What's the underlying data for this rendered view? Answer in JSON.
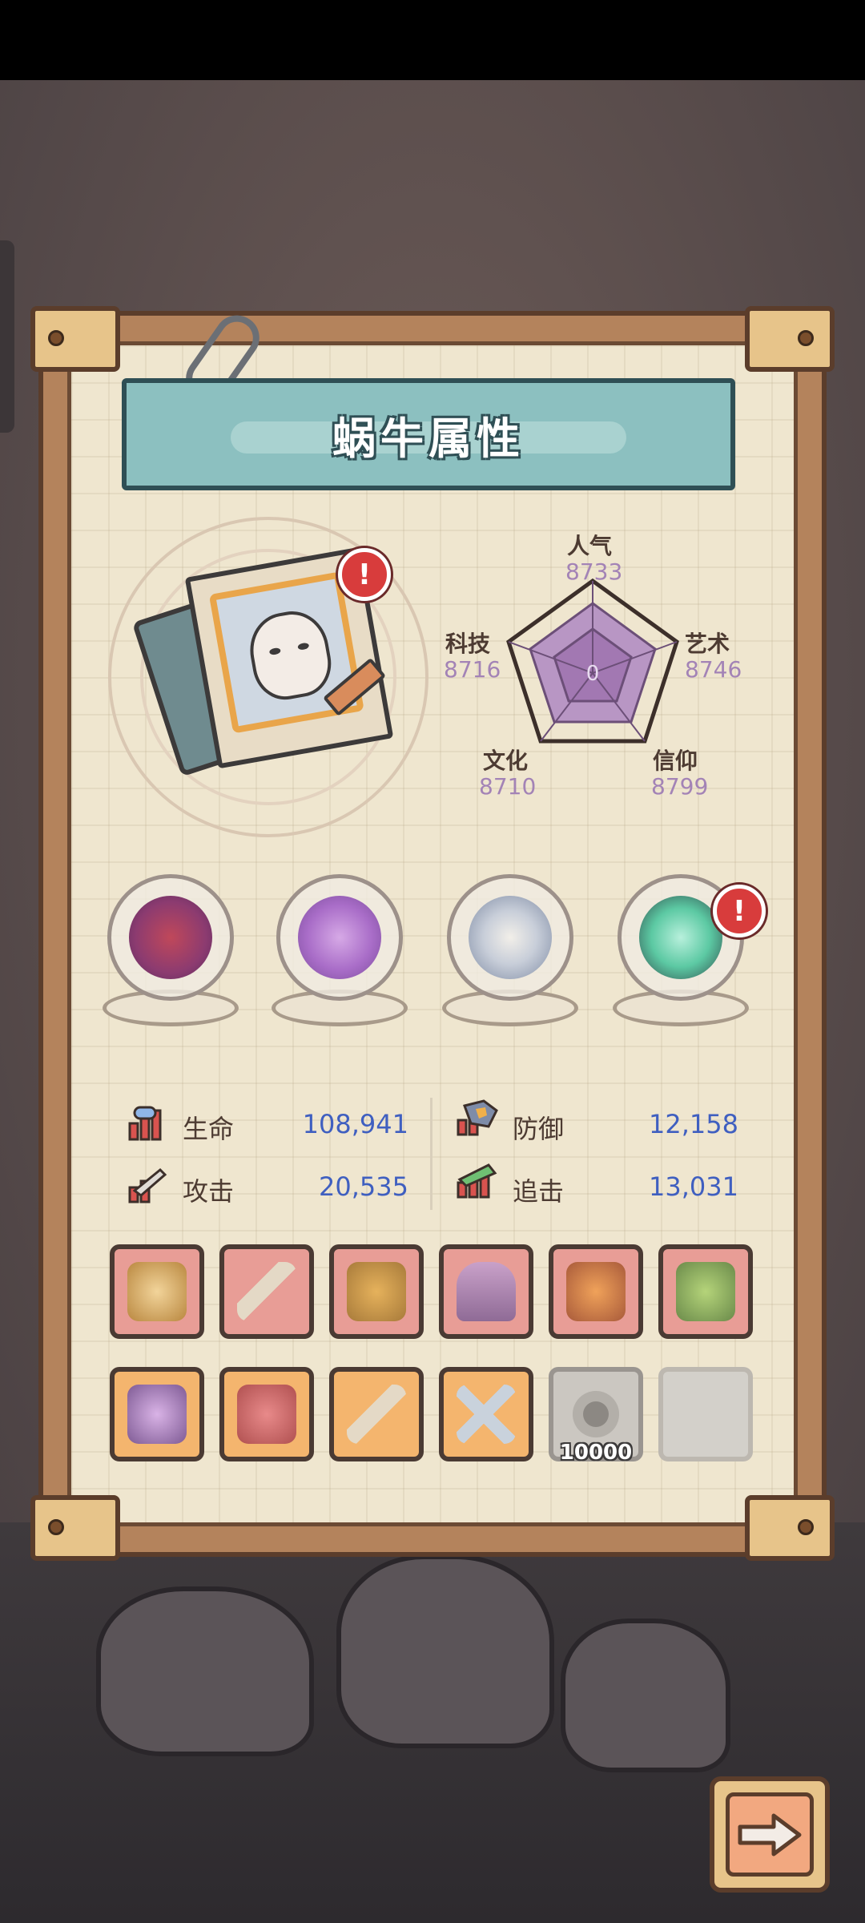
{
  "title": "蜗牛属性",
  "radar": {
    "stats": [
      {
        "name": "人气",
        "value": "8733"
      },
      {
        "name": "艺术",
        "value": "8746"
      },
      {
        "name": "信仰",
        "value": "8799"
      },
      {
        "name": "文化",
        "value": "8710"
      },
      {
        "name": "科技",
        "value": "8716"
      }
    ],
    "center_value": 0
  },
  "alerts": {
    "portrait": "!",
    "relic_4": "!"
  },
  "relics": [
    {
      "name": "thorn-vine-relic-icon"
    },
    {
      "name": "purple-claw-relic-icon"
    },
    {
      "name": "compass-relic-icon"
    },
    {
      "name": "green-swirl-portal-relic-icon"
    }
  ],
  "attributes": {
    "hp": {
      "label": "生命",
      "value": "108,941"
    },
    "defense": {
      "label": "防御",
      "value": "12,158"
    },
    "attack": {
      "label": "攻击",
      "value": "20,535"
    },
    "chase": {
      "label": "追击",
      "value": "13,031"
    }
  },
  "equipment_row1": [
    {
      "name": "gear-armor-icon",
      "color": "#e89d96"
    },
    {
      "name": "sword-icon",
      "color": "#e89d96"
    },
    {
      "name": "blaster-gun-icon",
      "color": "#e89d96"
    },
    {
      "name": "belt-icon",
      "color": "#e89d96"
    },
    {
      "name": "spiked-mace-icon",
      "color": "#e89d96"
    },
    {
      "name": "war-hammer-icon",
      "color": "#e89d96"
    }
  ],
  "equipment_row2": [
    {
      "name": "winged-helmet-icon",
      "color": "#f4b56e"
    },
    {
      "name": "chain-weights-icon",
      "color": "#f4b56e"
    },
    {
      "name": "dagger-icon",
      "color": "#f4b56e"
    },
    {
      "name": "crossed-blades-icon",
      "color": "#f4b56e"
    },
    {
      "name": "gear-upgrade-icon",
      "count": "10000"
    },
    {
      "name": "empty-slot"
    }
  ],
  "colors": {
    "value_blue": "#3f5fc0",
    "radar_value_purple": "#a383b6",
    "title_teal": "#8cc0c0"
  }
}
